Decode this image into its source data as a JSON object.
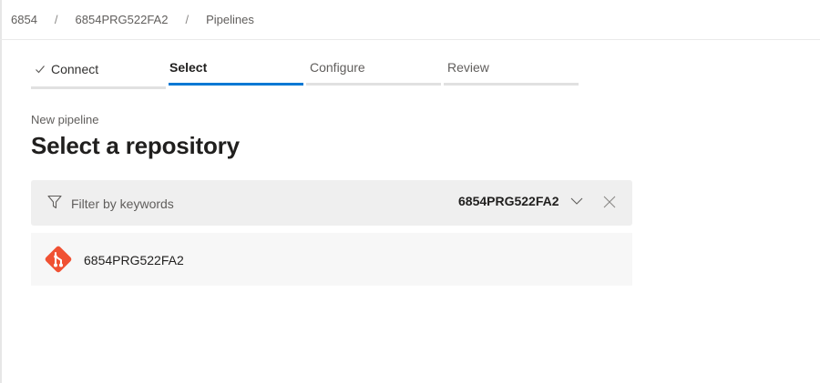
{
  "breadcrumb": {
    "items": [
      "6854",
      "6854PRG522FA2",
      "Pipelines"
    ],
    "separator": "/"
  },
  "wizard": {
    "steps": [
      {
        "label": "Connect",
        "state": "completed"
      },
      {
        "label": "Select",
        "state": "active"
      },
      {
        "label": "Configure",
        "state": "pending"
      },
      {
        "label": "Review",
        "state": "pending"
      }
    ]
  },
  "page": {
    "subtitle": "New pipeline",
    "title": "Select a repository"
  },
  "filter": {
    "placeholder": "Filter by keywords",
    "value": "",
    "scope_value": "6854PRG522FA2",
    "icons": {
      "filter": "filter-icon",
      "scope": "chevron-down-icon",
      "clear": "close-icon"
    }
  },
  "repositories": [
    {
      "name": "6854PRG522FA2",
      "icon": "git-icon"
    }
  ],
  "colors": {
    "accent": "#0078d4",
    "git": "#f05133",
    "filter_bg": "#efefef",
    "row_bg": "#f7f7f7"
  }
}
